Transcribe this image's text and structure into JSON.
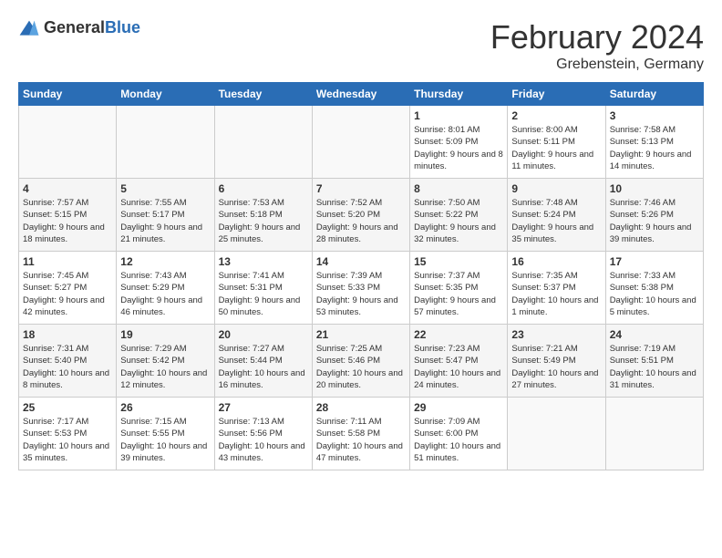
{
  "header": {
    "logo_general": "General",
    "logo_blue": "Blue",
    "month_title": "February 2024",
    "location": "Grebenstein, Germany"
  },
  "days_of_week": [
    "Sunday",
    "Monday",
    "Tuesday",
    "Wednesday",
    "Thursday",
    "Friday",
    "Saturday"
  ],
  "weeks": [
    [
      {
        "day": "",
        "empty": true
      },
      {
        "day": "",
        "empty": true
      },
      {
        "day": "",
        "empty": true
      },
      {
        "day": "",
        "empty": true
      },
      {
        "day": "1",
        "sunrise": "8:01 AM",
        "sunset": "5:09 PM",
        "daylight": "9 hours and 8 minutes."
      },
      {
        "day": "2",
        "sunrise": "8:00 AM",
        "sunset": "5:11 PM",
        "daylight": "9 hours and 11 minutes."
      },
      {
        "day": "3",
        "sunrise": "7:58 AM",
        "sunset": "5:13 PM",
        "daylight": "9 hours and 14 minutes."
      }
    ],
    [
      {
        "day": "4",
        "sunrise": "7:57 AM",
        "sunset": "5:15 PM",
        "daylight": "9 hours and 18 minutes."
      },
      {
        "day": "5",
        "sunrise": "7:55 AM",
        "sunset": "5:17 PM",
        "daylight": "9 hours and 21 minutes."
      },
      {
        "day": "6",
        "sunrise": "7:53 AM",
        "sunset": "5:18 PM",
        "daylight": "9 hours and 25 minutes."
      },
      {
        "day": "7",
        "sunrise": "7:52 AM",
        "sunset": "5:20 PM",
        "daylight": "9 hours and 28 minutes."
      },
      {
        "day": "8",
        "sunrise": "7:50 AM",
        "sunset": "5:22 PM",
        "daylight": "9 hours and 32 minutes."
      },
      {
        "day": "9",
        "sunrise": "7:48 AM",
        "sunset": "5:24 PM",
        "daylight": "9 hours and 35 minutes."
      },
      {
        "day": "10",
        "sunrise": "7:46 AM",
        "sunset": "5:26 PM",
        "daylight": "9 hours and 39 minutes."
      }
    ],
    [
      {
        "day": "11",
        "sunrise": "7:45 AM",
        "sunset": "5:27 PM",
        "daylight": "9 hours and 42 minutes."
      },
      {
        "day": "12",
        "sunrise": "7:43 AM",
        "sunset": "5:29 PM",
        "daylight": "9 hours and 46 minutes."
      },
      {
        "day": "13",
        "sunrise": "7:41 AM",
        "sunset": "5:31 PM",
        "daylight": "9 hours and 50 minutes."
      },
      {
        "day": "14",
        "sunrise": "7:39 AM",
        "sunset": "5:33 PM",
        "daylight": "9 hours and 53 minutes."
      },
      {
        "day": "15",
        "sunrise": "7:37 AM",
        "sunset": "5:35 PM",
        "daylight": "9 hours and 57 minutes."
      },
      {
        "day": "16",
        "sunrise": "7:35 AM",
        "sunset": "5:37 PM",
        "daylight": "10 hours and 1 minute."
      },
      {
        "day": "17",
        "sunrise": "7:33 AM",
        "sunset": "5:38 PM",
        "daylight": "10 hours and 5 minutes."
      }
    ],
    [
      {
        "day": "18",
        "sunrise": "7:31 AM",
        "sunset": "5:40 PM",
        "daylight": "10 hours and 8 minutes."
      },
      {
        "day": "19",
        "sunrise": "7:29 AM",
        "sunset": "5:42 PM",
        "daylight": "10 hours and 12 minutes."
      },
      {
        "day": "20",
        "sunrise": "7:27 AM",
        "sunset": "5:44 PM",
        "daylight": "10 hours and 16 minutes."
      },
      {
        "day": "21",
        "sunrise": "7:25 AM",
        "sunset": "5:46 PM",
        "daylight": "10 hours and 20 minutes."
      },
      {
        "day": "22",
        "sunrise": "7:23 AM",
        "sunset": "5:47 PM",
        "daylight": "10 hours and 24 minutes."
      },
      {
        "day": "23",
        "sunrise": "7:21 AM",
        "sunset": "5:49 PM",
        "daylight": "10 hours and 27 minutes."
      },
      {
        "day": "24",
        "sunrise": "7:19 AM",
        "sunset": "5:51 PM",
        "daylight": "10 hours and 31 minutes."
      }
    ],
    [
      {
        "day": "25",
        "sunrise": "7:17 AM",
        "sunset": "5:53 PM",
        "daylight": "10 hours and 35 minutes."
      },
      {
        "day": "26",
        "sunrise": "7:15 AM",
        "sunset": "5:55 PM",
        "daylight": "10 hours and 39 minutes."
      },
      {
        "day": "27",
        "sunrise": "7:13 AM",
        "sunset": "5:56 PM",
        "daylight": "10 hours and 43 minutes."
      },
      {
        "day": "28",
        "sunrise": "7:11 AM",
        "sunset": "5:58 PM",
        "daylight": "10 hours and 47 minutes."
      },
      {
        "day": "29",
        "sunrise": "7:09 AM",
        "sunset": "6:00 PM",
        "daylight": "10 hours and 51 minutes."
      },
      {
        "day": "",
        "empty": true
      },
      {
        "day": "",
        "empty": true
      }
    ]
  ]
}
